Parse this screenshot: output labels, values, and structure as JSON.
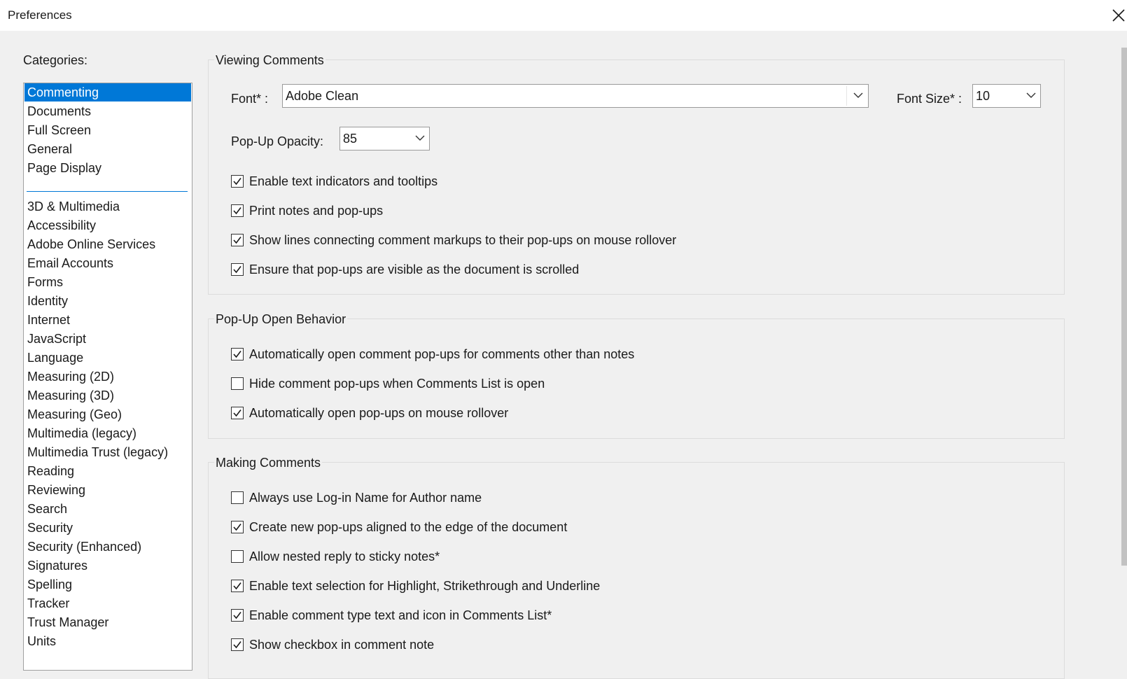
{
  "window": {
    "title": "Preferences"
  },
  "categories": {
    "label": "Categories:",
    "top_items": [
      "Commenting",
      "Documents",
      "Full Screen",
      "General",
      "Page Display"
    ],
    "selected": "Commenting",
    "items": [
      "3D & Multimedia",
      "Accessibility",
      "Adobe Online Services",
      "Email Accounts",
      "Forms",
      "Identity",
      "Internet",
      "JavaScript",
      "Language",
      "Measuring (2D)",
      "Measuring (3D)",
      "Measuring (Geo)",
      "Multimedia (legacy)",
      "Multimedia Trust (legacy)",
      "Reading",
      "Reviewing",
      "Search",
      "Security",
      "Security (Enhanced)",
      "Signatures",
      "Spelling",
      "Tracker",
      "Trust Manager",
      "Units"
    ]
  },
  "viewing": {
    "title": "Viewing Comments",
    "font_label": "Font* :",
    "font_value": "Adobe Clean",
    "size_label": "Font Size* :",
    "size_value": "10",
    "opacity_label": "Pop-Up Opacity:",
    "opacity_value": "85",
    "checks": [
      {
        "label": "Enable text indicators and tooltips",
        "checked": true
      },
      {
        "label": "Print notes and pop-ups",
        "checked": true
      },
      {
        "label": "Show lines connecting comment markups to their pop-ups on mouse rollover",
        "checked": true
      },
      {
        "label": "Ensure that pop-ups are visible as the document is scrolled",
        "checked": true
      }
    ]
  },
  "popup": {
    "title": "Pop-Up Open Behavior",
    "checks": [
      {
        "label": "Automatically open comment pop-ups for comments other than notes",
        "checked": true
      },
      {
        "label": "Hide comment pop-ups when Comments List is open",
        "checked": false
      },
      {
        "label": "Automatically open pop-ups on mouse rollover",
        "checked": true
      }
    ]
  },
  "making": {
    "title": "Making Comments",
    "checks": [
      {
        "label": "Always use Log-in Name for Author name",
        "checked": false
      },
      {
        "label": "Create new pop-ups aligned to the edge of the document",
        "checked": true
      },
      {
        "label": "Allow nested reply to sticky notes*",
        "checked": false
      },
      {
        "label": "Enable text selection for Highlight, Strikethrough and Underline",
        "checked": true
      },
      {
        "label": "Enable comment type text and icon in Comments List*",
        "checked": true
      },
      {
        "label": "Show checkbox in comment note",
        "checked": true
      }
    ]
  },
  "icons": {
    "close": "close-icon",
    "dropdown": "chevron-down-icon",
    "check": "checkmark-icon"
  }
}
